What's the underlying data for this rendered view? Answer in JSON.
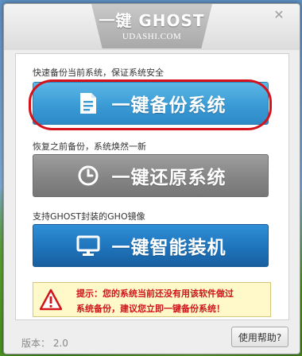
{
  "window": {
    "title": "一键 GHOST",
    "subtitle": "UDASHI.COM",
    "close_glyph": "✕"
  },
  "sections": [
    {
      "caption": "快速备份当前系统，保证系统安全",
      "button_label": "一键备份系统",
      "icon": "document-icon"
    },
    {
      "caption": "恢复之前备份，系统焕然一新",
      "button_label": "一键还原系统",
      "icon": "clock-icon"
    },
    {
      "caption": "支持GHOST封装的GHO镜像",
      "button_label": "一键智能装机",
      "icon": "monitor-icon"
    }
  ],
  "tip": {
    "line1": "提示：您的系统当前还没有用该软件做过",
    "line2": "系统备份，建议您立即一键备份系统！",
    "icon": "warning-icon"
  },
  "footer": {
    "version": "版本： 2.0",
    "help_label": "使用帮助?"
  },
  "colors": {
    "backup_button": "#3a9bd5",
    "restore_button": "#858585",
    "install_button": "#1f74bb",
    "highlight_ring": "#d5121b",
    "tip_text": "#d1141a"
  }
}
